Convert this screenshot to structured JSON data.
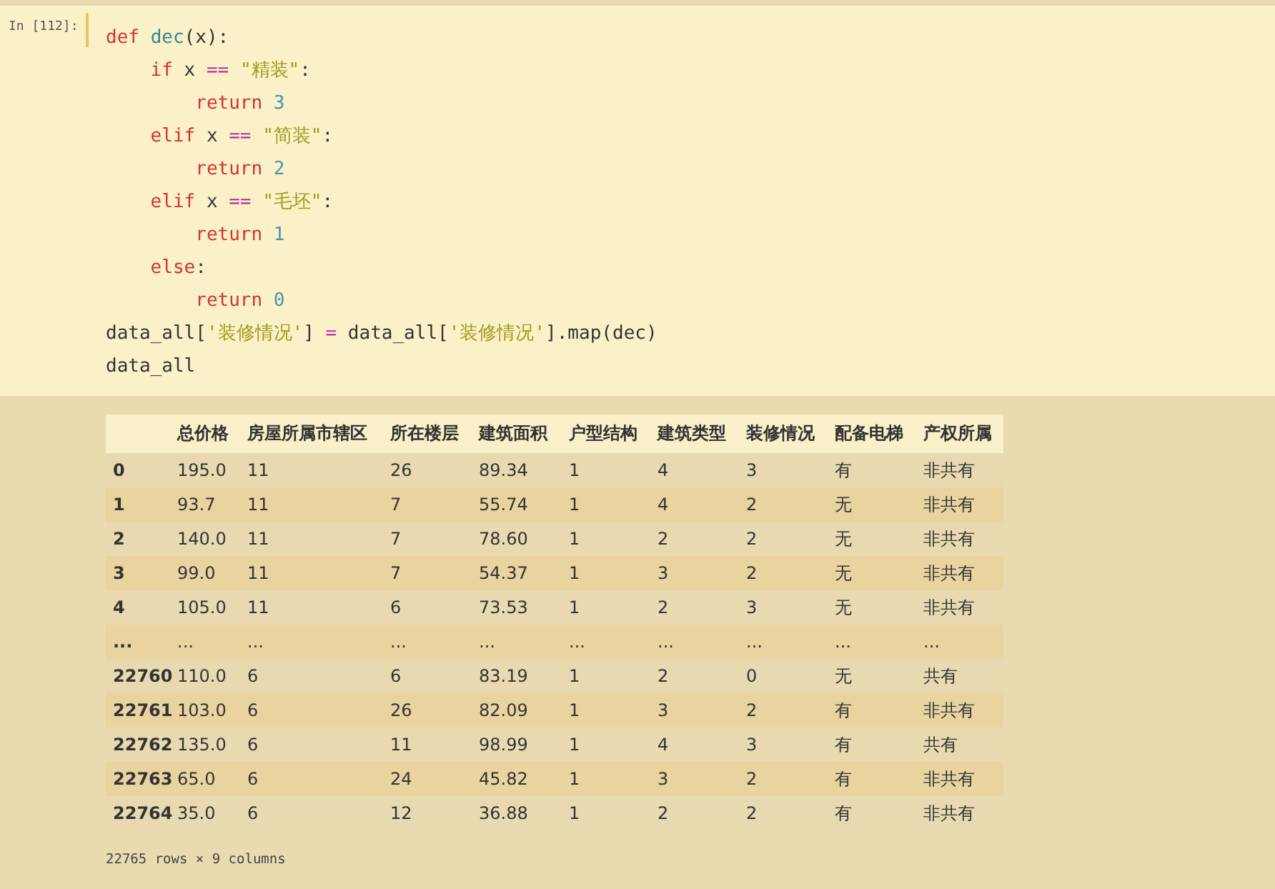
{
  "cell": {
    "prompt": "In [112]:",
    "code": [
      [
        {
          "kind": "keyword",
          "text": "def "
        },
        {
          "kind": "name",
          "text": "dec"
        },
        {
          "kind": "plain",
          "text": "(x):"
        }
      ],
      [
        {
          "kind": "keyword",
          "text": "    if"
        },
        {
          "kind": "plain",
          "text": " x "
        },
        {
          "kind": "operator",
          "text": "== "
        },
        {
          "kind": "string",
          "text": "\"精装\""
        },
        {
          "kind": "plain",
          "text": ":"
        }
      ],
      [
        {
          "kind": "keyword",
          "text": "        return "
        },
        {
          "kind": "number",
          "text": "3"
        }
      ],
      [
        {
          "kind": "keyword",
          "text": "    elif"
        },
        {
          "kind": "plain",
          "text": " x "
        },
        {
          "kind": "operator",
          "text": "== "
        },
        {
          "kind": "string",
          "text": "\"简装\""
        },
        {
          "kind": "plain",
          "text": ":"
        }
      ],
      [
        {
          "kind": "keyword",
          "text": "        return "
        },
        {
          "kind": "number",
          "text": "2"
        }
      ],
      [
        {
          "kind": "keyword",
          "text": "    elif"
        },
        {
          "kind": "plain",
          "text": " x "
        },
        {
          "kind": "operator",
          "text": "== "
        },
        {
          "kind": "string",
          "text": "\"毛坯\""
        },
        {
          "kind": "plain",
          "text": ":"
        }
      ],
      [
        {
          "kind": "keyword",
          "text": "        return "
        },
        {
          "kind": "number",
          "text": "1"
        }
      ],
      [
        {
          "kind": "keyword",
          "text": "    else"
        },
        {
          "kind": "plain",
          "text": ":"
        }
      ],
      [
        {
          "kind": "keyword",
          "text": "        return "
        },
        {
          "kind": "number",
          "text": "0"
        }
      ],
      [
        {
          "kind": "plain",
          "text": "data_all["
        },
        {
          "kind": "string",
          "text": "'装修情况'"
        },
        {
          "kind": "plain",
          "text": "] "
        },
        {
          "kind": "operator",
          "text": "= "
        },
        {
          "kind": "plain",
          "text": "data_all["
        },
        {
          "kind": "string",
          "text": "'装修情况'"
        },
        {
          "kind": "plain",
          "text": "].map(dec)"
        }
      ],
      [
        {
          "kind": "plain",
          "text": "data_all"
        }
      ]
    ]
  },
  "table": {
    "columns": [
      "总价格",
      "房屋所属市辖区",
      "所在楼层",
      "建筑面积",
      "户型结构",
      "建筑类型",
      "装修情况",
      "配备电梯",
      "产权所属"
    ],
    "rows": [
      {
        "index": "0",
        "cells": [
          "195.0",
          "11",
          "26",
          "89.34",
          "1",
          "4",
          "3",
          "有",
          "非共有"
        ]
      },
      {
        "index": "1",
        "cells": [
          "93.7",
          "11",
          "7",
          "55.74",
          "1",
          "4",
          "2",
          "无",
          "非共有"
        ]
      },
      {
        "index": "2",
        "cells": [
          "140.0",
          "11",
          "7",
          "78.60",
          "1",
          "2",
          "2",
          "无",
          "非共有"
        ]
      },
      {
        "index": "3",
        "cells": [
          "99.0",
          "11",
          "7",
          "54.37",
          "1",
          "3",
          "2",
          "无",
          "非共有"
        ]
      },
      {
        "index": "4",
        "cells": [
          "105.0",
          "11",
          "6",
          "73.53",
          "1",
          "2",
          "3",
          "无",
          "非共有"
        ]
      },
      {
        "index": "...",
        "cells": [
          "...",
          "...",
          "...",
          "...",
          "...",
          "...",
          "...",
          "...",
          "..."
        ]
      },
      {
        "index": "22760",
        "cells": [
          "110.0",
          "6",
          "6",
          "83.19",
          "1",
          "2",
          "0",
          "无",
          "共有"
        ]
      },
      {
        "index": "22761",
        "cells": [
          "103.0",
          "6",
          "26",
          "82.09",
          "1",
          "3",
          "2",
          "有",
          "非共有"
        ]
      },
      {
        "index": "22762",
        "cells": [
          "135.0",
          "6",
          "11",
          "98.99",
          "1",
          "4",
          "3",
          "有",
          "共有"
        ]
      },
      {
        "index": "22763",
        "cells": [
          "65.0",
          "6",
          "24",
          "45.82",
          "1",
          "3",
          "2",
          "有",
          "非共有"
        ]
      },
      {
        "index": "22764",
        "cells": [
          "35.0",
          "6",
          "12",
          "36.88",
          "1",
          "2",
          "2",
          "有",
          "非共有"
        ]
      }
    ]
  },
  "summary": "22765 rows × 9 columns"
}
